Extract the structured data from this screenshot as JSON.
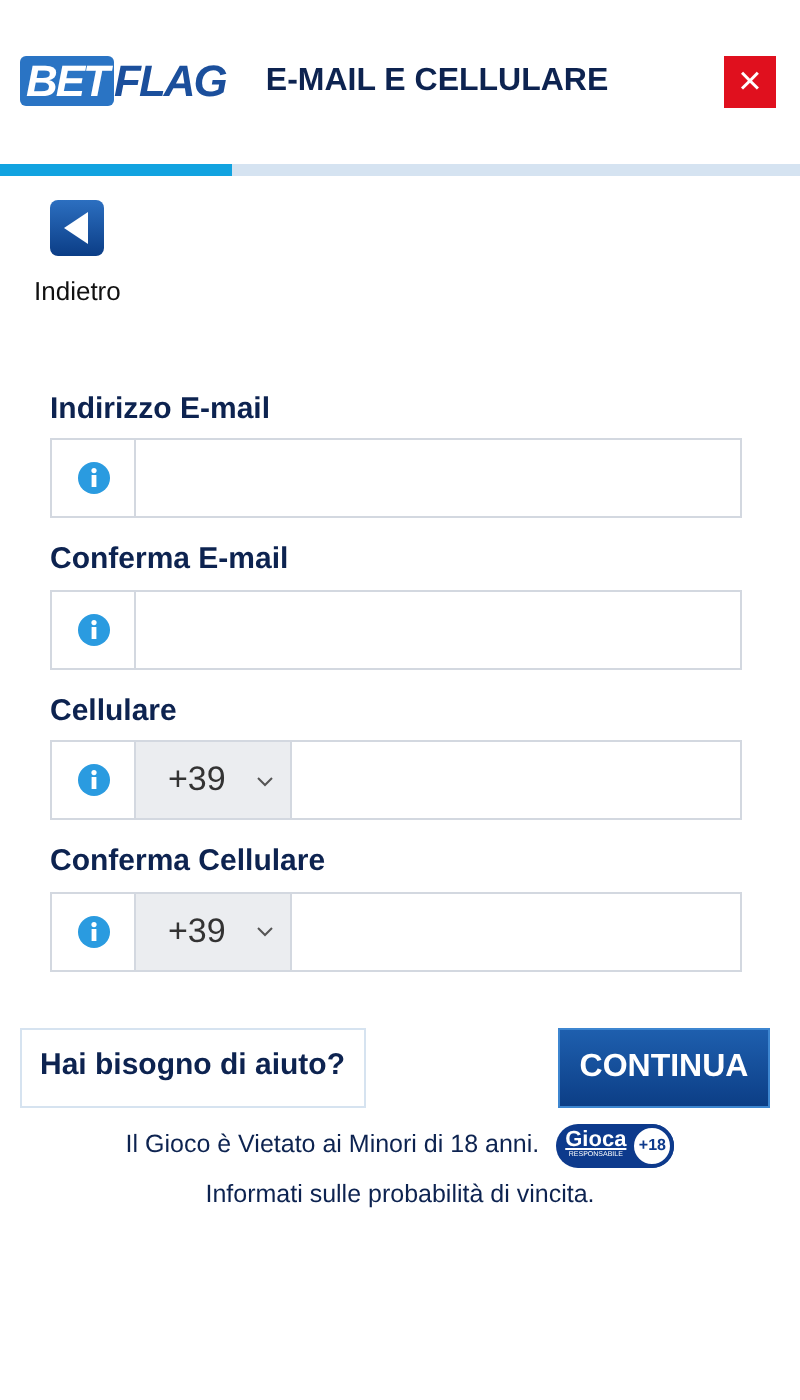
{
  "header": {
    "logo": [
      "BET",
      "FLAG"
    ],
    "title": "E-MAIL E CELLULARE",
    "close": "×"
  },
  "progress": {
    "level": 0.29
  },
  "back": {
    "label": "Indietro"
  },
  "fields": [
    {
      "label": "Indirizzo E-mail",
      "kind": "text"
    },
    {
      "label": "Conferma E-mail",
      "kind": "text"
    },
    {
      "label": "Cellulare",
      "kind": "phone",
      "prefix": "+39"
    },
    {
      "label": "Conferma Cellulare",
      "kind": "phone",
      "prefix": "+39"
    }
  ],
  "buttons": {
    "help": "Hai bisogno di aiuto?",
    "continue": "CONTINUA"
  },
  "footer": {
    "notice": "Il Gioco è Vietato ai Minori di 18 anni.",
    "badge": {
      "word": "Gioca",
      "sub": "RESPONSABILE",
      "age": "+18"
    },
    "info": "Informati sulle probabilità di vincita."
  }
}
